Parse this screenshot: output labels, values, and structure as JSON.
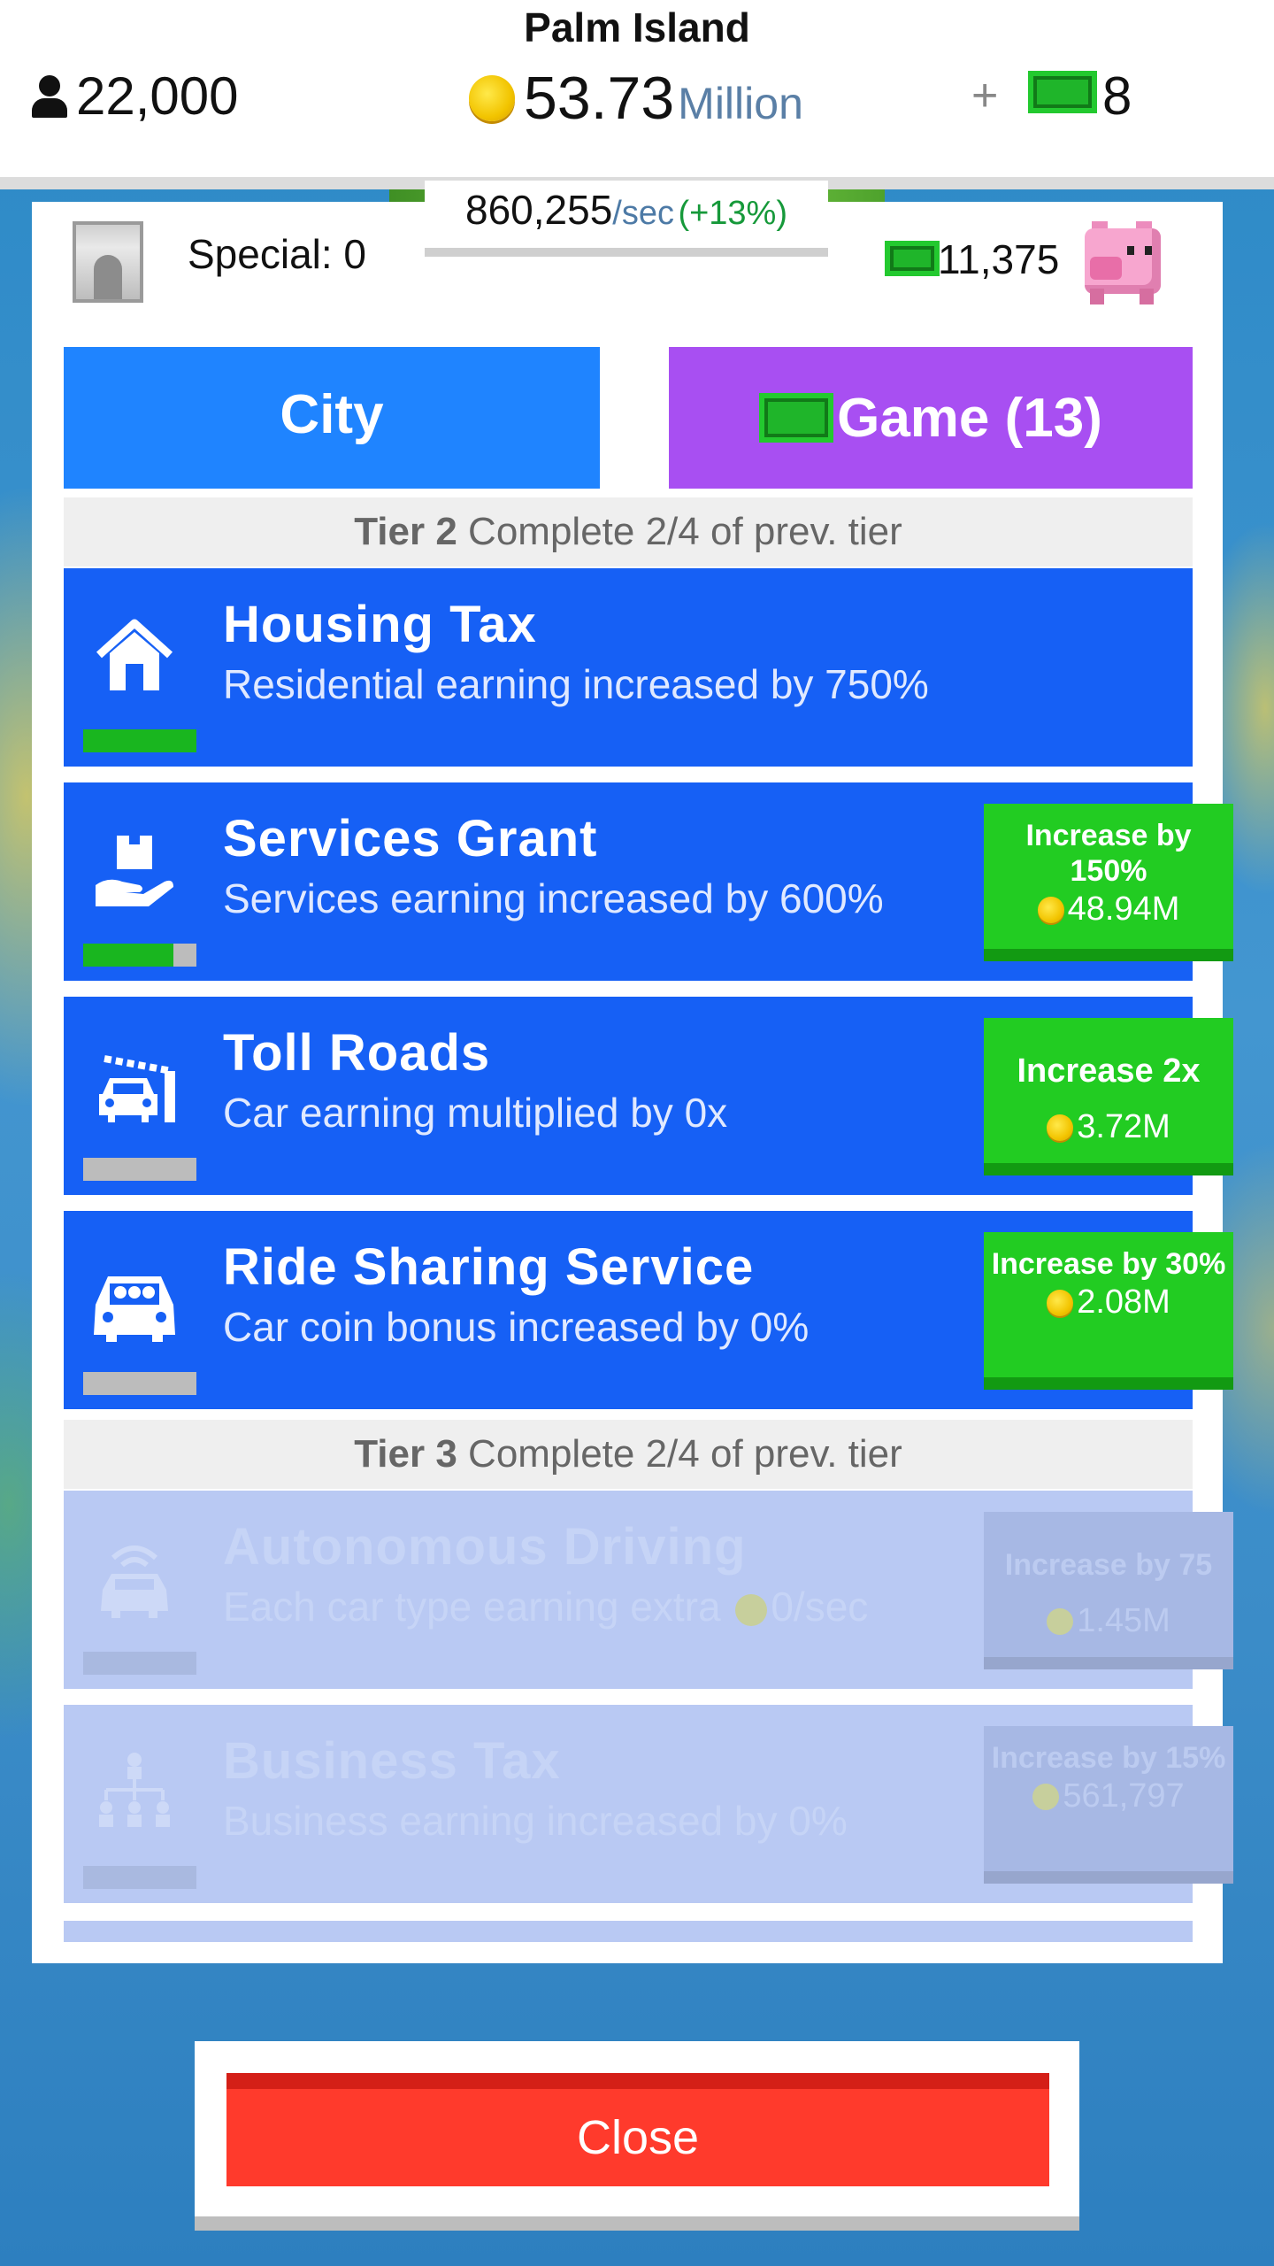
{
  "header": {
    "island_name": "Palm Island",
    "population": "22,000",
    "coins": "53.73",
    "coins_unit": "Million",
    "plus": "+",
    "cash": "8"
  },
  "stats": {
    "special_label": "Special: 0",
    "rate": "860,255",
    "rate_unit": "/sec",
    "rate_bonus": "(+13%)",
    "cash_balance": "11,375"
  },
  "tabs": {
    "city": "City",
    "game": "Game (13)"
  },
  "tiers": [
    {
      "name": "Tier 2",
      "requirement": "Complete 2/4 of prev. tier",
      "upgrades": [
        {
          "title": "Housing Tax",
          "desc": "Residential earning increased by 750%",
          "icon": "house-icon",
          "progress": 1.0,
          "button": null
        },
        {
          "title": "Services Grant",
          "desc": "Services earning increased by 600%",
          "icon": "hand-box-icon",
          "progress": 0.8,
          "button": {
            "label": "Increase by 150%",
            "cost": "48.94M"
          }
        },
        {
          "title": "Toll Roads",
          "desc": "Car earning multiplied by 0x",
          "icon": "toll-gate-car-icon",
          "progress": 0,
          "button": {
            "label": "Increase 2x",
            "cost": "3.72M"
          }
        },
        {
          "title": "Ride Sharing Service",
          "desc": "Car coin bonus increased by 0%",
          "icon": "shared-car-icon",
          "progress": 0,
          "button": {
            "label": "Increase by 30%",
            "cost": "2.08M"
          }
        }
      ]
    },
    {
      "name": "Tier 3",
      "requirement": "Complete 2/4 of prev. tier",
      "upgrades": [
        {
          "title": "Autonomous Driving",
          "desc": "Each car type earning extra",
          "desc_suffix": "0/sec",
          "icon": "wireless-car-icon",
          "progress": 0,
          "button": {
            "label": "Increase by 75",
            "cost": "1.45M"
          }
        },
        {
          "title": "Business Tax",
          "desc": "Business earning increased by 0%",
          "icon": "org-chart-icon",
          "progress": 0,
          "button": {
            "label": "Increase by 15%",
            "cost": "561,797"
          }
        }
      ]
    }
  ],
  "close_label": "Close",
  "colors": {
    "row_active": "#1660f5",
    "row_locked": "#b9c9f3",
    "buy_button": "#22cc22",
    "tab_city": "#1f84ff",
    "tab_game": "#a84ff2",
    "close": "#ff3a2c"
  }
}
